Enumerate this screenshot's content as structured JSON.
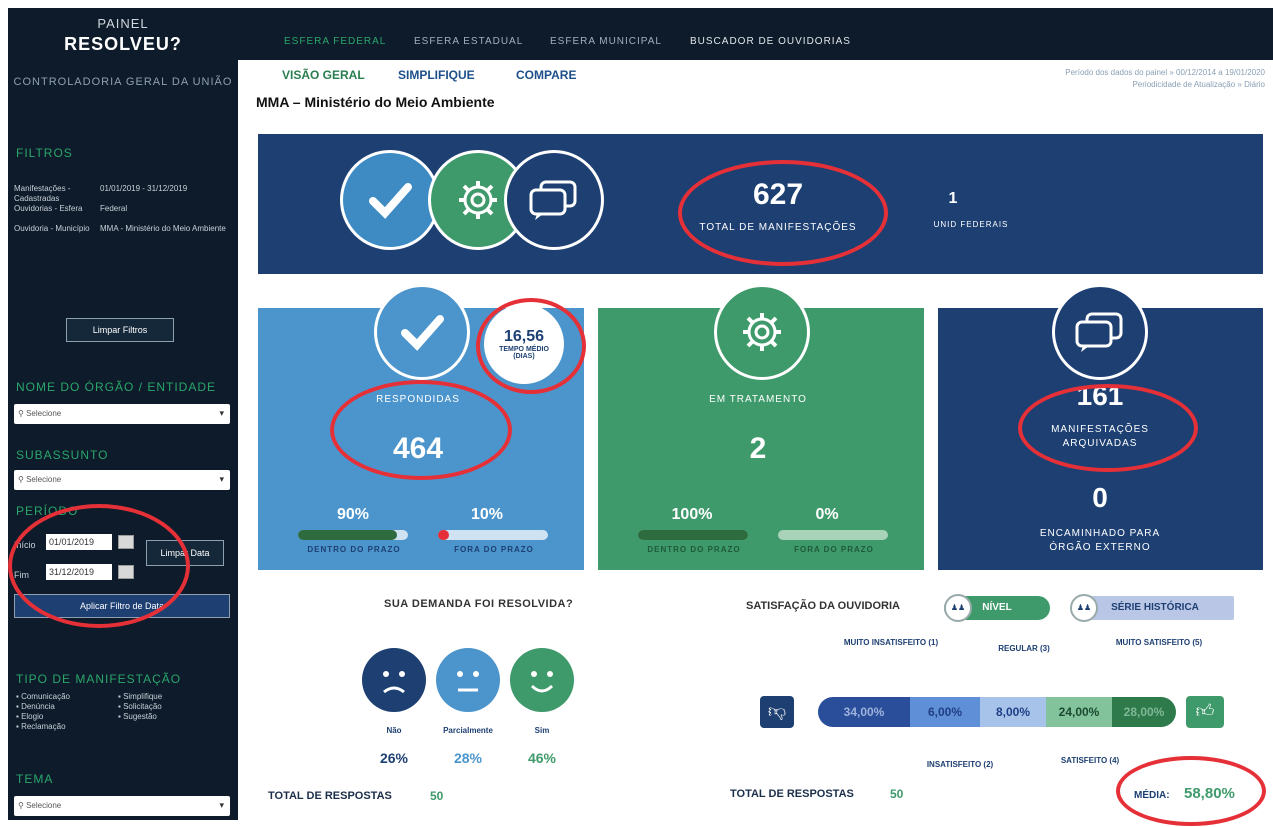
{
  "sidebar": {
    "title1": "PAINEL",
    "title2": "RESOLVEU?",
    "subtitle": "CONTROLADORIA GERAL DA UNIÃO",
    "filtros_heading": "FILTROS",
    "filter_labels": [
      "Manifestações - Cadastradas",
      "Ouvidorias - Esfera",
      "Ouvidoria - Município"
    ],
    "filter_values": [
      "01/01/2019 - 31/12/2019",
      "Federal",
      "MMA - Ministério do Meio Ambiente"
    ],
    "clear_filters": "Limpar Filtros",
    "orgao_heading": "NOME DO ÓRGÃO / ENTIDADE",
    "orgao_placeholder": "Selecione",
    "subassunto_heading": "SUBASSUNTO",
    "subassunto_placeholder": "Selecione",
    "periodo_heading": "PERÍODO",
    "inicio_label": "Início",
    "inicio_value": "01/01/2019",
    "fim_label": "Fim",
    "fim_value": "31/12/2019",
    "clear_date": "Limpar Data",
    "apply_date": "Aplicar Filtro de Data",
    "tipo_heading": "TIPO DE MANIFESTAÇÃO",
    "tipo_col1": [
      "Comunicação",
      "Denúncia",
      "Elogio",
      "Reclamação"
    ],
    "tipo_col2": [
      "Simplifique",
      "Solicitação",
      "Sugestão"
    ],
    "tema_heading": "TEMA",
    "tema_placeholder": "Selecione"
  },
  "topnav": [
    "ESFERA FEDERAL",
    "ESFERA ESTADUAL",
    "ESFERA MUNICIPAL",
    "BUSCADOR DE OUVIDORIAS"
  ],
  "subnav": [
    "VISÃO GERAL",
    "SIMPLIFIQUE",
    "COMPARE"
  ],
  "page_title": "MMA – Ministério do Meio Ambiente",
  "info_line1": "Período dos dados do painel » 00/12/2014 a 19/01/2020",
  "info_line2": "Periodicidade de Atualização » Diário",
  "summary": {
    "total": "627",
    "total_label": "TOTAL DE MANIFESTAÇÕES",
    "units": "1",
    "units_label": "UNID FEDERAIS"
  },
  "respondidas": {
    "tempo": "16,56",
    "tempo_label1": "TEMPO MÉDIO",
    "tempo_label2": "(DIAS)",
    "label": "RESPONDIDAS",
    "value": "464",
    "pct_dentro": "90%",
    "pct_fora": "10%",
    "dentro_frac": 0.9,
    "fora_frac": 0.1,
    "dentro_label": "DENTRO DO PRAZO",
    "fora_label": "FORA DO PRAZO"
  },
  "tratamento": {
    "label": "EM TRATAMENTO",
    "value": "2",
    "pct_dentro": "100%",
    "pct_fora": "0%",
    "dentro_frac": 1.0,
    "fora_frac": 0.0,
    "dentro_label": "DENTRO DO PRAZO",
    "fora_label": "FORA DO PRAZO"
  },
  "arquivadas": {
    "value": "161",
    "label1": "MANIFESTAÇÕES",
    "label2": "ARQUIVADAS",
    "encaminhado": "0",
    "enc_label1": "ENCAMINHADO PARA",
    "enc_label2": "ÓRGÃO EXTERNO"
  },
  "resolvida": {
    "title": "SUA DEMANDA FOI RESOLVIDA?",
    "options": [
      "Não",
      "Parcialmente",
      "Sim"
    ],
    "pcts": [
      "26%",
      "28%",
      "46%"
    ],
    "total_label": "TOTAL DE RESPOSTAS",
    "total": "50"
  },
  "satisfacao": {
    "title": "SATISFAÇÃO DA OUVIDORIA",
    "tab_nivel": "NÍVEL",
    "tab_serie": "SÉRIE HISTÓRICA",
    "top_labels": [
      "MUITO INSATISFEITO (1)",
      "REGULAR (3)",
      "MUITO SATISFEITO (5)"
    ],
    "bottom_labels": [
      "INSATISFEITO (2)",
      "SATISFEITO (4)"
    ],
    "segments": [
      "34,00%",
      "6,00%",
      "8,00%",
      "24,00%",
      "28,00%"
    ],
    "total_label": "TOTAL DE RESPOSTAS",
    "total": "50",
    "media_label": "MÉDIA:",
    "media": "58,80%"
  },
  "colors": {
    "navy": "#0d1b2a",
    "blue_dark": "#1d3f72",
    "blue_light": "#3e8bc4",
    "green": "#3f9a6b",
    "red": "#e53038"
  }
}
